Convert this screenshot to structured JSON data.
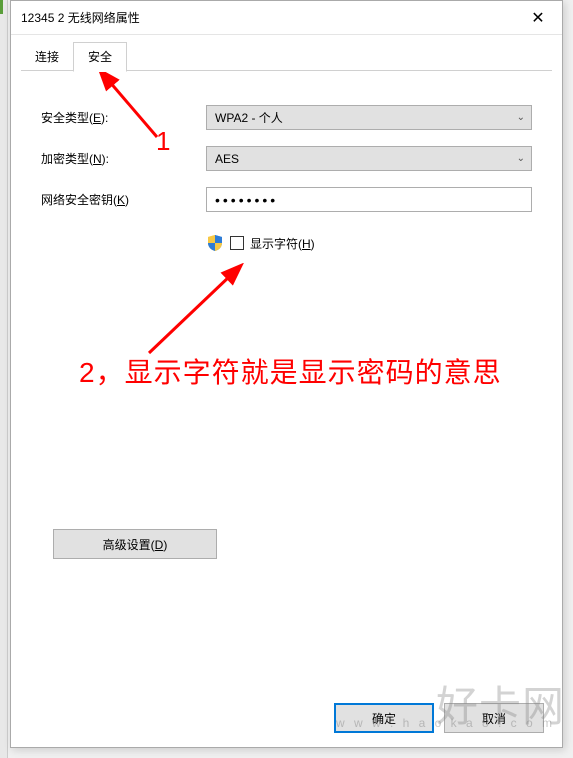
{
  "window": {
    "title": "12345 2 无线网络属性",
    "close": "✕"
  },
  "tabs": {
    "connect": "连接",
    "security": "安全"
  },
  "form": {
    "securityTypeLabel": "安全类型(E):",
    "securityTypeValue": "WPA2 - 个人",
    "encryptionTypeLabel": "加密类型(N):",
    "encryptionTypeValue": "AES",
    "keyLabel": "网络安全密钥(K)",
    "keyValue": "••••••••",
    "showCharsLabel": "显示字符(H)"
  },
  "buttons": {
    "advanced": "高级设置(D)",
    "ok": "确定",
    "cancel": "取消"
  },
  "annotations": {
    "one": "1",
    "two": "2，显示字符就是显示密码的意思"
  },
  "watermark": {
    "big": "好卡网",
    "small": "w w w . h a o k a 8 . c o m"
  }
}
